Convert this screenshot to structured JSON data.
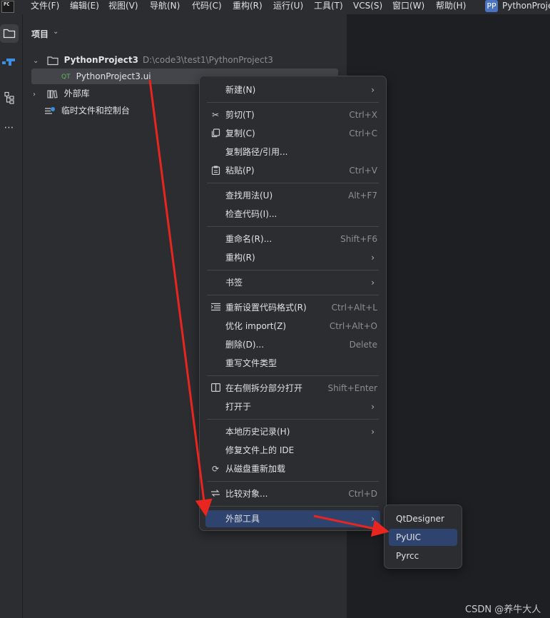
{
  "menubar": {
    "items": [
      "文件(F)",
      "编辑(E)",
      "视图(V)",
      "导航(N)",
      "代码(C)",
      "重构(R)",
      "运行(U)",
      "工具(T)",
      "VCS(S)",
      "窗口(W)",
      "帮助(H)"
    ],
    "app_logo": "PC",
    "project_badge": "PP",
    "project_name": "PythonProje"
  },
  "toolstrip": {
    "icons": [
      "folder-icon",
      "plugin-icon",
      "structure-icon",
      "more-icon"
    ],
    "more": "⋯"
  },
  "project_panel": {
    "title": "项目",
    "tree": {
      "root_name": "PythonProject3",
      "root_path": "D:\\code3\\test1\\PythonProject3",
      "file_tag": "QT",
      "file_name": "PythonProject3.ui",
      "external_libs": "外部库",
      "scratches": "临时文件和控制台"
    }
  },
  "context_menu": {
    "items": [
      {
        "label": "新建(N)",
        "shortcut": "",
        "submenu": true,
        "icon": ""
      },
      {
        "label": "剪切(T)",
        "shortcut": "Ctrl+X",
        "submenu": false,
        "icon": "scissors-icon"
      },
      {
        "label": "复制(C)",
        "shortcut": "Ctrl+C",
        "submenu": false,
        "icon": "copy-icon"
      },
      {
        "label": "复制路径/引用...",
        "shortcut": "",
        "submenu": false,
        "icon": ""
      },
      {
        "label": "粘贴(P)",
        "shortcut": "Ctrl+V",
        "submenu": false,
        "icon": "clipboard-icon"
      },
      {
        "label": "查找用法(U)",
        "shortcut": "Alt+F7",
        "submenu": false,
        "icon": ""
      },
      {
        "label": "检查代码(I)...",
        "shortcut": "",
        "submenu": false,
        "icon": ""
      },
      {
        "label": "重命名(R)...",
        "shortcut": "Shift+F6",
        "submenu": false,
        "icon": ""
      },
      {
        "label": "重构(R)",
        "shortcut": "",
        "submenu": true,
        "icon": ""
      },
      {
        "label": "书签",
        "shortcut": "",
        "submenu": true,
        "icon": ""
      },
      {
        "label": "重新设置代码格式(R)",
        "shortcut": "Ctrl+Alt+L",
        "submenu": false,
        "icon": "format-icon"
      },
      {
        "label": "优化 import(Z)",
        "shortcut": "Ctrl+Alt+O",
        "submenu": false,
        "icon": ""
      },
      {
        "label": "删除(D)...",
        "shortcut": "Delete",
        "submenu": false,
        "icon": ""
      },
      {
        "label": "重写文件类型",
        "shortcut": "",
        "submenu": false,
        "icon": ""
      },
      {
        "label": "在右侧拆分部分打开",
        "shortcut": "Shift+Enter",
        "submenu": false,
        "icon": "split-icon"
      },
      {
        "label": "打开于",
        "shortcut": "",
        "submenu": true,
        "icon": ""
      },
      {
        "label": "本地历史记录(H)",
        "shortcut": "",
        "submenu": true,
        "icon": ""
      },
      {
        "label": "修复文件上的 IDE",
        "shortcut": "",
        "submenu": false,
        "icon": ""
      },
      {
        "label": "从磁盘重新加载",
        "shortcut": "",
        "submenu": false,
        "icon": "reload-icon"
      },
      {
        "label": "比较对象...",
        "shortcut": "Ctrl+D",
        "submenu": false,
        "icon": "compare-icon"
      },
      {
        "label": "外部工具",
        "shortcut": "",
        "submenu": true,
        "icon": "",
        "selected": true
      }
    ],
    "arrow_glyph": "›"
  },
  "submenu": {
    "items": [
      {
        "label": "QtDesigner",
        "selected": false
      },
      {
        "label": "PyUIC",
        "selected": true
      },
      {
        "label": "Pyrcc",
        "selected": false
      }
    ]
  },
  "annotation": {
    "color": "#e8261f"
  },
  "watermark": "CSDN @养牛大人",
  "colors": {
    "menubar_bg": "#2b2d30",
    "editor_bg": "#1e1f22",
    "selection": "#2e436e",
    "tree_selection": "#43454a",
    "badge": "#4a73c2"
  }
}
